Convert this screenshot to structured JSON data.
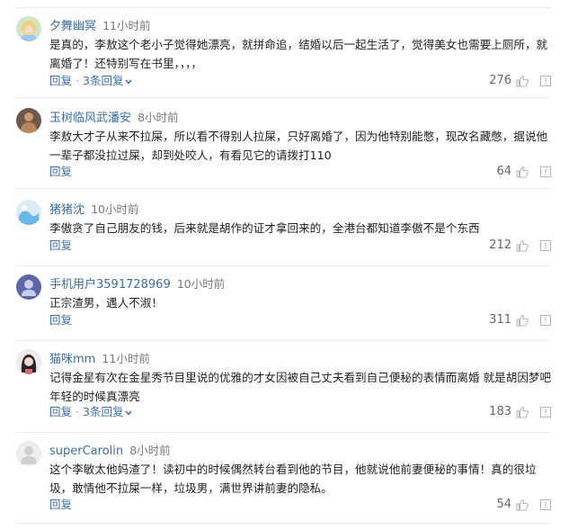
{
  "comments": [
    {
      "username": "夕舞幽冥",
      "time": "11小时前",
      "text": "是真的，李敖这个老小子觉得她漂亮，就拼命追，结婚以后一起生活了，觉得美女也需要上厕所，就离婚了！还特别写在书里，，，，",
      "reply_label": "回复",
      "replies_label": "3条回复",
      "likes": "276",
      "avatar_icon": "blonde-avatar-icon"
    },
    {
      "username": "玉树临风武潘安",
      "time": "8小时前",
      "text": "李敖大才子从来不拉屎，所以看不得别人拉屎，只好离婚了，因为他特别能憋，现改名藏憋，据说他一辈子都没拉过屎，却到处咬人，有看见它的请拨打110",
      "reply_label": "回复",
      "likes": "64",
      "avatar_icon": "muscle-man-avatar-icon"
    },
    {
      "username": "猪猪沈",
      "time": "10小时前",
      "text": "李傲贪了自己朋友的钱，后来就是胡作的证才拿回来的，全港台都知道李傲不是个东西",
      "reply_label": "回复",
      "likes": "212",
      "avatar_icon": "blue-wave-avatar-icon"
    },
    {
      "username": "手机用户3591728969",
      "time": "10小时前",
      "text": "正宗渣男，遇人不淑！",
      "reply_label": "回复",
      "likes": "311",
      "avatar_icon": "default-user-avatar-icon"
    },
    {
      "username": "猫咪mm",
      "time": "11小时前",
      "text": "记得金星有次在金星秀节目里说的优雅的才女因被自己丈夫看到自己便秘的表情而离婚 就是胡因梦吧 年轻的时候真漂亮",
      "reply_label": "回复",
      "replies_label": "3条回复",
      "likes": "183",
      "avatar_icon": "girl-avatar-icon"
    },
    {
      "username": "superCarolin",
      "time": "8小时前",
      "text": "这个李敏太他妈渣了！读初中的时候偶然转台看到他的节目，他就说他前妻便秘的事情！真的很垃圾，敢情他不拉屎一样，垃圾男，满世界讲前妻的隐私。",
      "reply_label": "回复",
      "likes": "54",
      "avatar_icon": "default-gray-avatar-icon"
    }
  ],
  "colors": {
    "link": "#3a6ea5",
    "text": "#222222",
    "meta": "#777777",
    "divider": "#ececec"
  }
}
